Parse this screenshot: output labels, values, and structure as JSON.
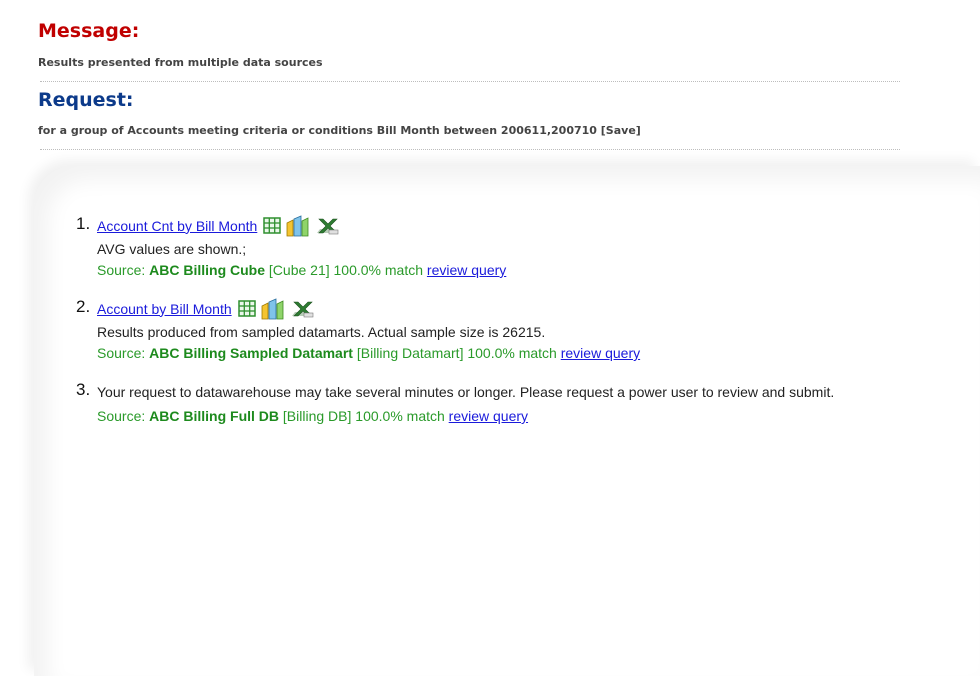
{
  "message": {
    "heading": "Message:",
    "text": "Results presented from multiple data sources"
  },
  "request": {
    "heading": "Request:",
    "text": "for a group of Accounts meeting criteria or conditions Bill Month between 200611,200710 [Save]"
  },
  "results": [
    {
      "number": "1.",
      "title": "Account Cnt by Bill Month",
      "note": "AVG values are shown.;",
      "source_label": "Source:",
      "source_name": "ABC Billing Cube",
      "source_detail": "[Cube 21] 100.0% match",
      "review_label": "review query",
      "icons": [
        "grid-table-icon",
        "bar-chart-icon",
        "excel-export-icon"
      ]
    },
    {
      "number": "2.",
      "title": "Account by Bill Month",
      "note": "Results produced from sampled datamarts. Actual sample size is 26215.",
      "source_label": "Source:",
      "source_name": "ABC Billing Sampled Datamart",
      "source_detail": "[Billing Datamart] 100.0% match",
      "review_label": "review query",
      "icons": [
        "grid-table-icon",
        "bar-chart-icon",
        "excel-export-icon"
      ]
    },
    {
      "number": "3.",
      "note": "Your request to datawarehouse may take several minutes or longer. Please request a power user to review and submit.",
      "source_label": "Source:",
      "source_name": "ABC Billing Full DB",
      "source_detail": "[Billing DB] 100.0% match",
      "review_label": "review query"
    }
  ],
  "colors": {
    "message_heading": "#c00000",
    "request_heading": "#0c3a8a",
    "link": "#1a1adb",
    "source_text": "#2a9a2a"
  }
}
